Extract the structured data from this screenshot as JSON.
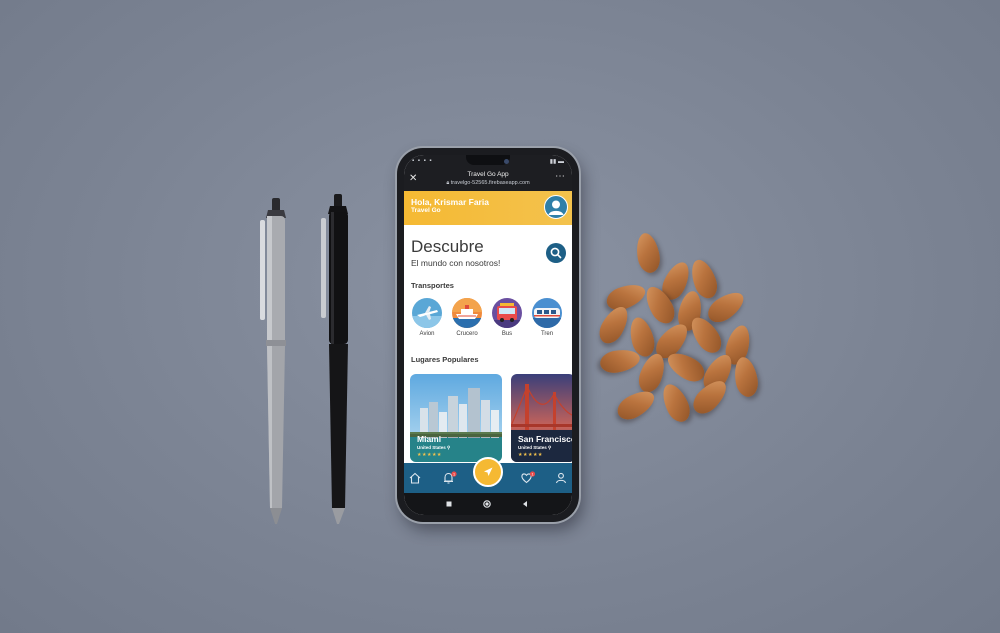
{
  "browser": {
    "title": "Travel Go App",
    "url": "travelgo-52565.firebaseapp.com"
  },
  "header": {
    "greeting": "Hola, Krismar Faria",
    "brand": "Travel Go"
  },
  "hero": {
    "title": "Descubre",
    "subtitle": "El mundo con nosotros!"
  },
  "transports": {
    "heading": "Transportes",
    "items": [
      {
        "label": "Avion",
        "icon": "airplane-icon"
      },
      {
        "label": "Crucero",
        "icon": "cruise-ship-icon"
      },
      {
        "label": "Bus",
        "icon": "bus-icon"
      },
      {
        "label": "Tren",
        "icon": "train-icon"
      }
    ]
  },
  "popular": {
    "heading": "Lugares Populares",
    "places": [
      {
        "name": "Miami",
        "country": "United States",
        "rating": 5,
        "stars": "★★★★★"
      },
      {
        "name": "San Francisco",
        "country": "United States",
        "rating": 5,
        "stars": "★★★★★"
      }
    ]
  },
  "bottom_nav": {
    "items": [
      "home-icon",
      "bell-icon",
      "navigate-icon",
      "heart-icon",
      "user-icon"
    ],
    "badges": {
      "notifications": "1",
      "favorites": "1"
    }
  },
  "colors": {
    "accent": "#f5b933",
    "primary": "#1d5f86",
    "background": "#7d8595"
  }
}
